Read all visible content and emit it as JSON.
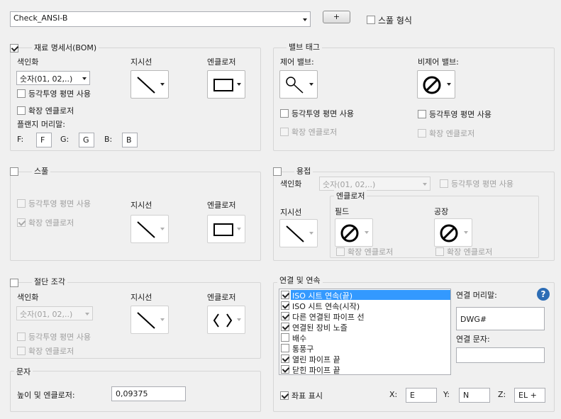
{
  "top": {
    "style_value": "Check_ANSI-B",
    "add_button": "+",
    "spool_format_label": "스풀 형식"
  },
  "bom": {
    "title": "재료 명세서(BOM)",
    "index_label": "색인화",
    "index_value": "숫자(01, 02,..)",
    "iso_plane": "등각투영 평면 사용",
    "ext_enclosure": "확장 엔클로저",
    "flange_label": "플랜지 머리말:",
    "leader_label": "지시선",
    "enclosure_label": "엔클로저",
    "f_label": "F:",
    "f_value": "F",
    "g_label": "G:",
    "g_value": "G",
    "b_label": "B:",
    "b_value": "B"
  },
  "valve": {
    "title": "밸브 태그",
    "controlled": "제어 밸브:",
    "uncontrolled": "비제어 밸브:",
    "iso_plane_1": "등각투영 평면 사용",
    "iso_plane_2": "등각투영 평면 사용",
    "ext_1": "확장 엔클로저",
    "ext_2": "확장 엔클로저"
  },
  "spool": {
    "title": "스풀",
    "iso_plane": "등각투영 평면 사용",
    "ext_enclosure": "확장 엔클로저",
    "leader_label": "지시선",
    "enclosure_label": "엔클로저"
  },
  "weld": {
    "title": "용접",
    "index_label": "색인화",
    "index_value": "숫자(01, 02,..)",
    "iso_plane": "등각투영 평면 사용",
    "enclosure_group": "엔클로저",
    "leader_label": "지시선",
    "field_label": "필드",
    "shop_label": "공장",
    "ext_1": "확장 엔클로저",
    "ext_2": "확장 엔클로저"
  },
  "cut": {
    "title": "절단 조각",
    "index_label": "색인화",
    "index_value": "숫자(01, 02,..)",
    "iso_plane": "등각투영 평면 사용",
    "ext_enclosure": "확장 엔클로저",
    "leader_label": "지시선",
    "enclosure_label": "엔클로저"
  },
  "text": {
    "title": "문자",
    "height_label": "높이 및 엔클로저:",
    "height_value": "0,09375"
  },
  "connections": {
    "title": "연결 및 연속",
    "items": [
      {
        "label": "ISO 시트 연속(끝)",
        "checked": true,
        "selected": true
      },
      {
        "label": "ISO 시트 연속(시작)",
        "checked": true,
        "selected": false
      },
      {
        "label": "다른 연결된 파이프 선",
        "checked": true,
        "selected": false
      },
      {
        "label": "연결된 장비 노즐",
        "checked": true,
        "selected": false
      },
      {
        "label": "배수",
        "checked": false,
        "selected": false
      },
      {
        "label": "통풍구",
        "checked": false,
        "selected": false
      },
      {
        "label": "열린 파이프 끝",
        "checked": true,
        "selected": false
      },
      {
        "label": "닫힌 파이프 끝",
        "checked": true,
        "selected": false
      }
    ],
    "prefix_label": "연결 머리말:",
    "prefix_value": "DWG#",
    "text_label": "연결 문자:",
    "text_value": "",
    "show_coords": "좌표 표시",
    "x_label": "X:",
    "x_value": "E",
    "y_label": "Y:",
    "y_value": "N",
    "z_label": "Z:",
    "z_value": "EL +",
    "help": "?"
  }
}
